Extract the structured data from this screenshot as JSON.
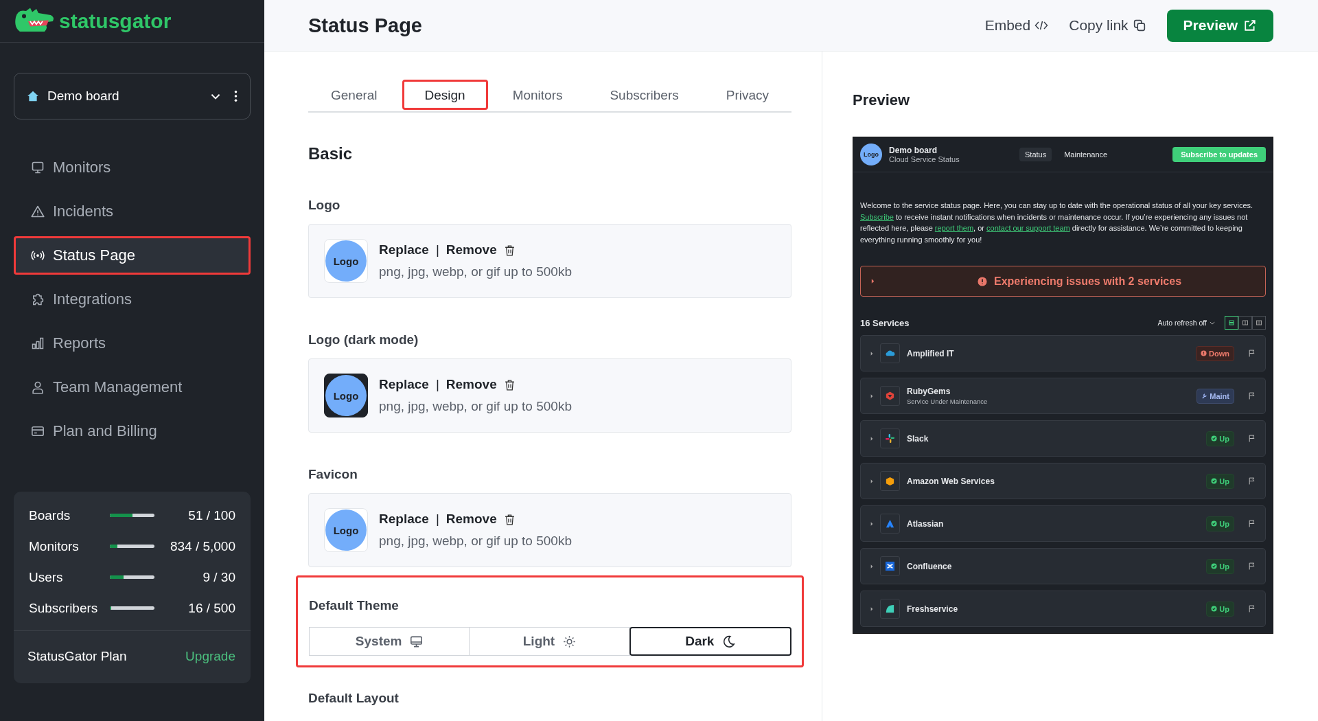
{
  "brand": {
    "name": "statusgator"
  },
  "board_selector": {
    "label": "Demo board"
  },
  "nav": [
    {
      "label": "Monitors",
      "selected": false
    },
    {
      "label": "Incidents",
      "selected": false
    },
    {
      "label": "Status Page",
      "selected": true
    },
    {
      "label": "Integrations",
      "selected": false
    },
    {
      "label": "Reports",
      "selected": false
    },
    {
      "label": "Team Management",
      "selected": false
    },
    {
      "label": "Plan and Billing",
      "selected": false
    }
  ],
  "usage": [
    {
      "label": "Boards",
      "level": 0.51,
      "reading": "51 / 100"
    },
    {
      "label": "Monitors",
      "level": 0.17,
      "reading": "834 / 5,000"
    },
    {
      "label": "Users",
      "level": 0.3,
      "reading": "9 / 30"
    },
    {
      "label": "Subscribers",
      "level": 0.03,
      "reading": "16 / 500"
    }
  ],
  "plan": {
    "label": "StatusGator Plan",
    "action": "Upgrade"
  },
  "header": {
    "title": "Status Page",
    "embed": "Embed",
    "copy": "Copy link",
    "preview": "Preview"
  },
  "tabs": [
    {
      "label": "General",
      "selected": false
    },
    {
      "label": "Design",
      "selected": true
    },
    {
      "label": "Monitors",
      "selected": false
    },
    {
      "label": "Subscribers",
      "selected": false
    },
    {
      "label": "Privacy",
      "selected": false
    }
  ],
  "section_title": "Basic",
  "uploads": [
    {
      "label": "Logo",
      "kind": "light",
      "logo": "Logo",
      "replace": "Replace",
      "separator": "|",
      "remove": "Remove",
      "hint": "png, jpg, webp, or gif up to 500kb"
    },
    {
      "label": "Logo (dark mode)",
      "kind": "dark",
      "logo": "Logo",
      "replace": "Replace",
      "separator": "|",
      "remove": "Remove",
      "hint": "png, jpg, webp, or gif up to 500kb"
    },
    {
      "label": "Favicon",
      "kind": "light",
      "logo": "Logo",
      "replace": "Replace",
      "separator": "|",
      "remove": "Remove",
      "hint": "png, jpg, webp, or gif up to 500kb"
    }
  ],
  "theme": {
    "label": "Default Theme",
    "highlighted": true,
    "options": [
      {
        "label": "System",
        "selected": false
      },
      {
        "label": "Light",
        "selected": false
      },
      {
        "label": "Dark",
        "selected": true
      }
    ]
  },
  "layout_label": "Default Layout",
  "preview": {
    "title": "Preview",
    "logo": "Logo",
    "board": "Demo board",
    "subtitle": "Cloud Service Status",
    "nav": [
      {
        "label": "Status",
        "selected": true
      },
      {
        "label": "Maintenance",
        "selected": false
      }
    ],
    "subscribe": "Subscribe to updates",
    "intro": [
      {
        "text": "Welcome to the service status page. Here, you can stay up to date with the operational status of all your key services. ",
        "link": false
      },
      {
        "text": "Subscribe",
        "link": true
      },
      {
        "text": " to receive instant notifications when incidents or maintenance occur. If you’re experiencing any issues not reflected here, please ",
        "link": false
      },
      {
        "text": "report them",
        "link": true
      },
      {
        "text": ", or ",
        "link": false
      },
      {
        "text": "contact our support team",
        "link": true
      },
      {
        "text": " directly for assistance. We’re committed to keeping everything running smoothly for you!",
        "link": false
      }
    ],
    "alert": "Experiencing issues with 2 services",
    "count": "16 Services",
    "refresh": "Auto refresh off",
    "views": [
      {
        "selected": true
      },
      {
        "selected": false
      },
      {
        "selected": false
      }
    ],
    "services": [
      {
        "name": "Amplified IT",
        "status": {
          "kind": "down",
          "label": "Down"
        }
      },
      {
        "name": "RubyGems",
        "note": "Service Under Maintenance",
        "status": {
          "kind": "maint",
          "label": "Maint"
        }
      },
      {
        "name": "Slack",
        "status": {
          "kind": "up",
          "label": "Up"
        }
      },
      {
        "name": "Amazon Web Services",
        "status": {
          "kind": "up",
          "label": "Up"
        }
      },
      {
        "name": "Atlassian",
        "status": {
          "kind": "up",
          "label": "Up"
        }
      },
      {
        "name": "Confluence",
        "status": {
          "kind": "up",
          "label": "Up"
        }
      },
      {
        "name": "Freshservice",
        "status": {
          "kind": "up",
          "label": "Up"
        }
      }
    ]
  }
}
